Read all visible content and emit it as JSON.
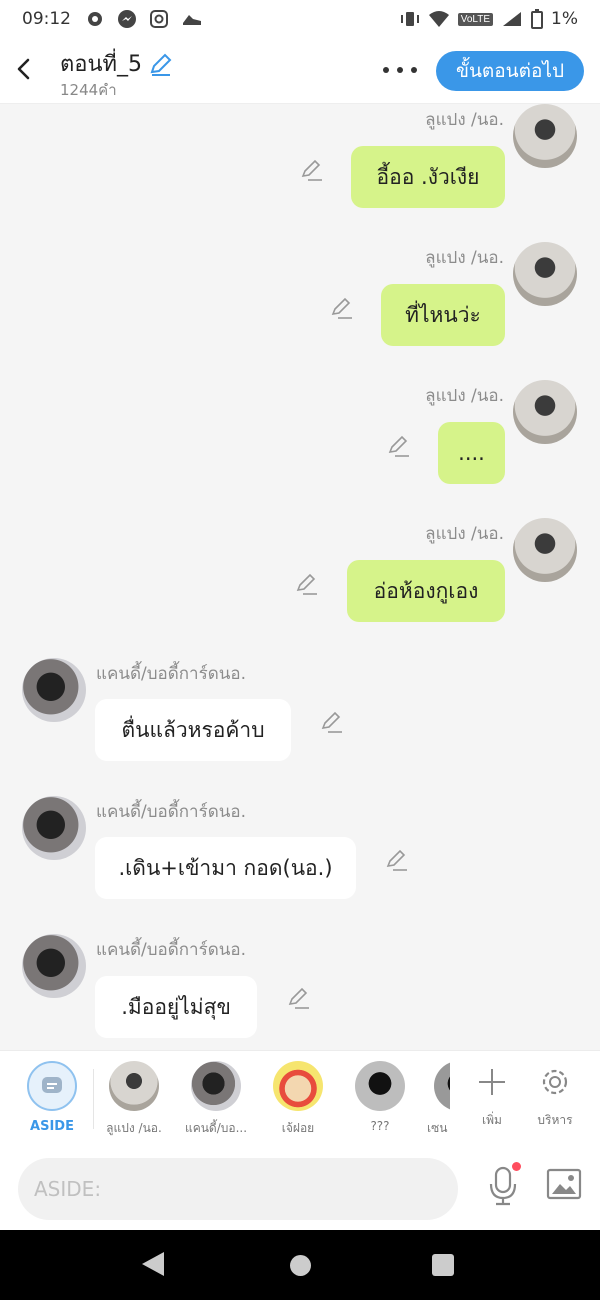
{
  "status_bar": {
    "time": "09:12",
    "network": "VoLTE",
    "battery": "1%"
  },
  "header": {
    "title": "ตอนที่_5",
    "word_count": "1244คำ",
    "next_button": "ขั้นตอนต่อไป"
  },
  "messages": [
    {
      "side": "right",
      "name": "ลูแปง /นอ.",
      "text": "อี้ออ .งัวเงีย"
    },
    {
      "side": "right",
      "name": "ลูแปง /นอ.",
      "text": "ที่ไหนว่ะ"
    },
    {
      "side": "right",
      "name": "ลูแปง /นอ.",
      "text": "...."
    },
    {
      "side": "right",
      "name": "ลูแปง /นอ.",
      "text": "อ่อห้องกูเอง"
    },
    {
      "side": "left",
      "name": "แคนดี้/บอดี้การ์ดนอ.",
      "text": "ตื่นแล้วหรอค้าบ"
    },
    {
      "side": "left",
      "name": "แคนดี้/บอดี้การ์ดนอ.",
      "text": ".เดิน+เข้ามา กอด(นอ.)"
    },
    {
      "side": "left",
      "name": "แคนดี้/บอดี้การ์ดนอ.",
      "text": ".มืออยู่ไม่สุข"
    }
  ],
  "characters": [
    {
      "label": "ASIDE"
    },
    {
      "label": "ลูแปง /นอ."
    },
    {
      "label": "แคนดี้/บอ..."
    },
    {
      "label": "เจ้ฝอย"
    },
    {
      "label": "???"
    },
    {
      "label": "เซน"
    }
  ],
  "char_actions": {
    "add": "เพิ่ม",
    "manage": "บริหาร"
  },
  "input": {
    "placeholder": "ASIDE:"
  },
  "colors": {
    "accent": "#3a97e8",
    "my_bubble": "#d6f38a",
    "other_bubble": "#ffffff"
  }
}
